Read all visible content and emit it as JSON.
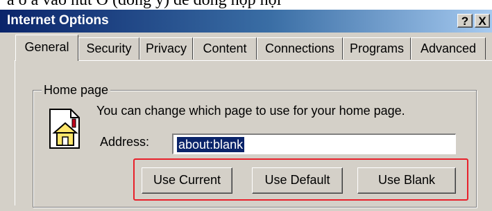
{
  "background_text": "à ô à vào nút O (đồng ý) để đóng hộp hội",
  "window": {
    "title": "Internet Options",
    "help_button": "?",
    "close_button": "X"
  },
  "tabs": [
    "General",
    "Security",
    "Privacy",
    "Content",
    "Connections",
    "Programs",
    "Advanced"
  ],
  "active_tab": "General",
  "home_page": {
    "group_label": "Home page",
    "description": "You can change which page to use for your home page.",
    "address_label": "Address:",
    "address_value": "about:blank",
    "buttons": {
      "use_current": "Use Current",
      "use_default": "Use Default",
      "use_blank": "Use Blank"
    }
  },
  "highlight_color": "#e8202a",
  "icon": "home-page-icon"
}
